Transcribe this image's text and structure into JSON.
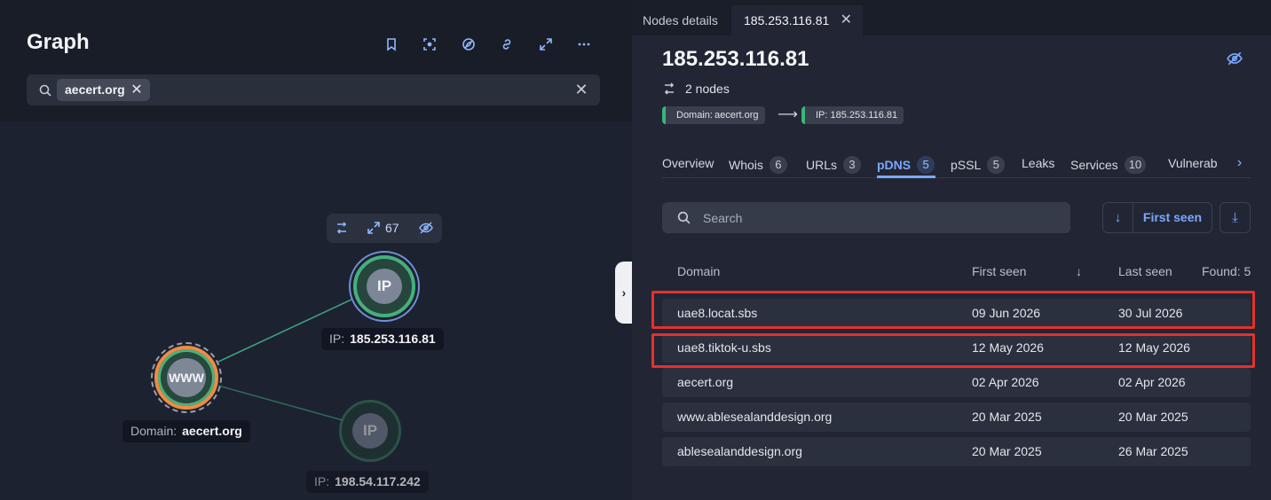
{
  "graph": {
    "title": "Graph",
    "toolbar_icons": [
      "bookmark-icon",
      "focus-icon",
      "compass-icon",
      "link-icon",
      "expand-icon",
      "more-icon"
    ],
    "search": {
      "chip": "aecert.org",
      "chip_remove": "✕",
      "clear": "✕"
    },
    "node_toolbar": {
      "expand_count": "67"
    },
    "nodes": {
      "ip1": {
        "glyph": "IP",
        "label_key": "IP:",
        "label_value": "185.253.116.81"
      },
      "www": {
        "glyph": "WWW",
        "label_key": "Domain:",
        "label_value": "aecert.org"
      },
      "ip2": {
        "glyph": "IP",
        "label_key": "IP:",
        "label_value": "198.54.117.242"
      }
    },
    "edge_color": "#3ea784",
    "collapse_handle": "›"
  },
  "details": {
    "tabs": {
      "nodes": "Nodes details",
      "ip": "185.253.116.81",
      "ip_close": "✕"
    },
    "title": "185.253.116.81",
    "nodes_count": "2 nodes",
    "path": {
      "from_key": "Domain:",
      "from_value": "aecert.org",
      "arrow": "⟶",
      "to_key": "IP:",
      "to_value": "185.253.116.81"
    },
    "sub_tabs": [
      {
        "label": "Overview",
        "badge": ""
      },
      {
        "label": "Whois",
        "badge": "6"
      },
      {
        "label": "URLs",
        "badge": "3"
      },
      {
        "label": "pDNS",
        "badge": "5",
        "active": true
      },
      {
        "label": "pSSL",
        "badge": "5"
      },
      {
        "label": "Leaks",
        "badge": ""
      },
      {
        "label": "Services",
        "badge": "10"
      },
      {
        "label": "Vulnerab",
        "badge": ""
      }
    ],
    "sub_tabs_next": "›",
    "search": {
      "placeholder": "Search"
    },
    "sort": {
      "direction": "↓",
      "field": "First seen"
    },
    "download": "⤓",
    "table": {
      "headers": {
        "domain": "Domain",
        "first_seen": "First seen",
        "sort_arrow": "↓",
        "last_seen": "Last seen",
        "found": "Found: 5"
      },
      "rows": [
        {
          "domain": "uae8.locat.sbs",
          "first_seen": "09 Jun 2026",
          "last_seen": "30 Jul 2026",
          "highlighted": true
        },
        {
          "domain": "uae8.tiktok-u.sbs",
          "first_seen": "12 May 2026",
          "last_seen": "12 May 2026",
          "highlighted": true
        },
        {
          "domain": "aecert.org",
          "first_seen": "02 Apr 2026",
          "last_seen": "02 Apr 2026"
        },
        {
          "domain": "www.ablesealanddesign.org",
          "first_seen": "20 Mar 2025",
          "last_seen": "20 Mar 2025"
        },
        {
          "domain": "ablesealanddesign.org",
          "first_seen": "20 Mar 2025",
          "last_seen": "26 Mar 2025"
        }
      ]
    },
    "accent": "#7aa8ff",
    "highlight_color": "#e6302b"
  }
}
